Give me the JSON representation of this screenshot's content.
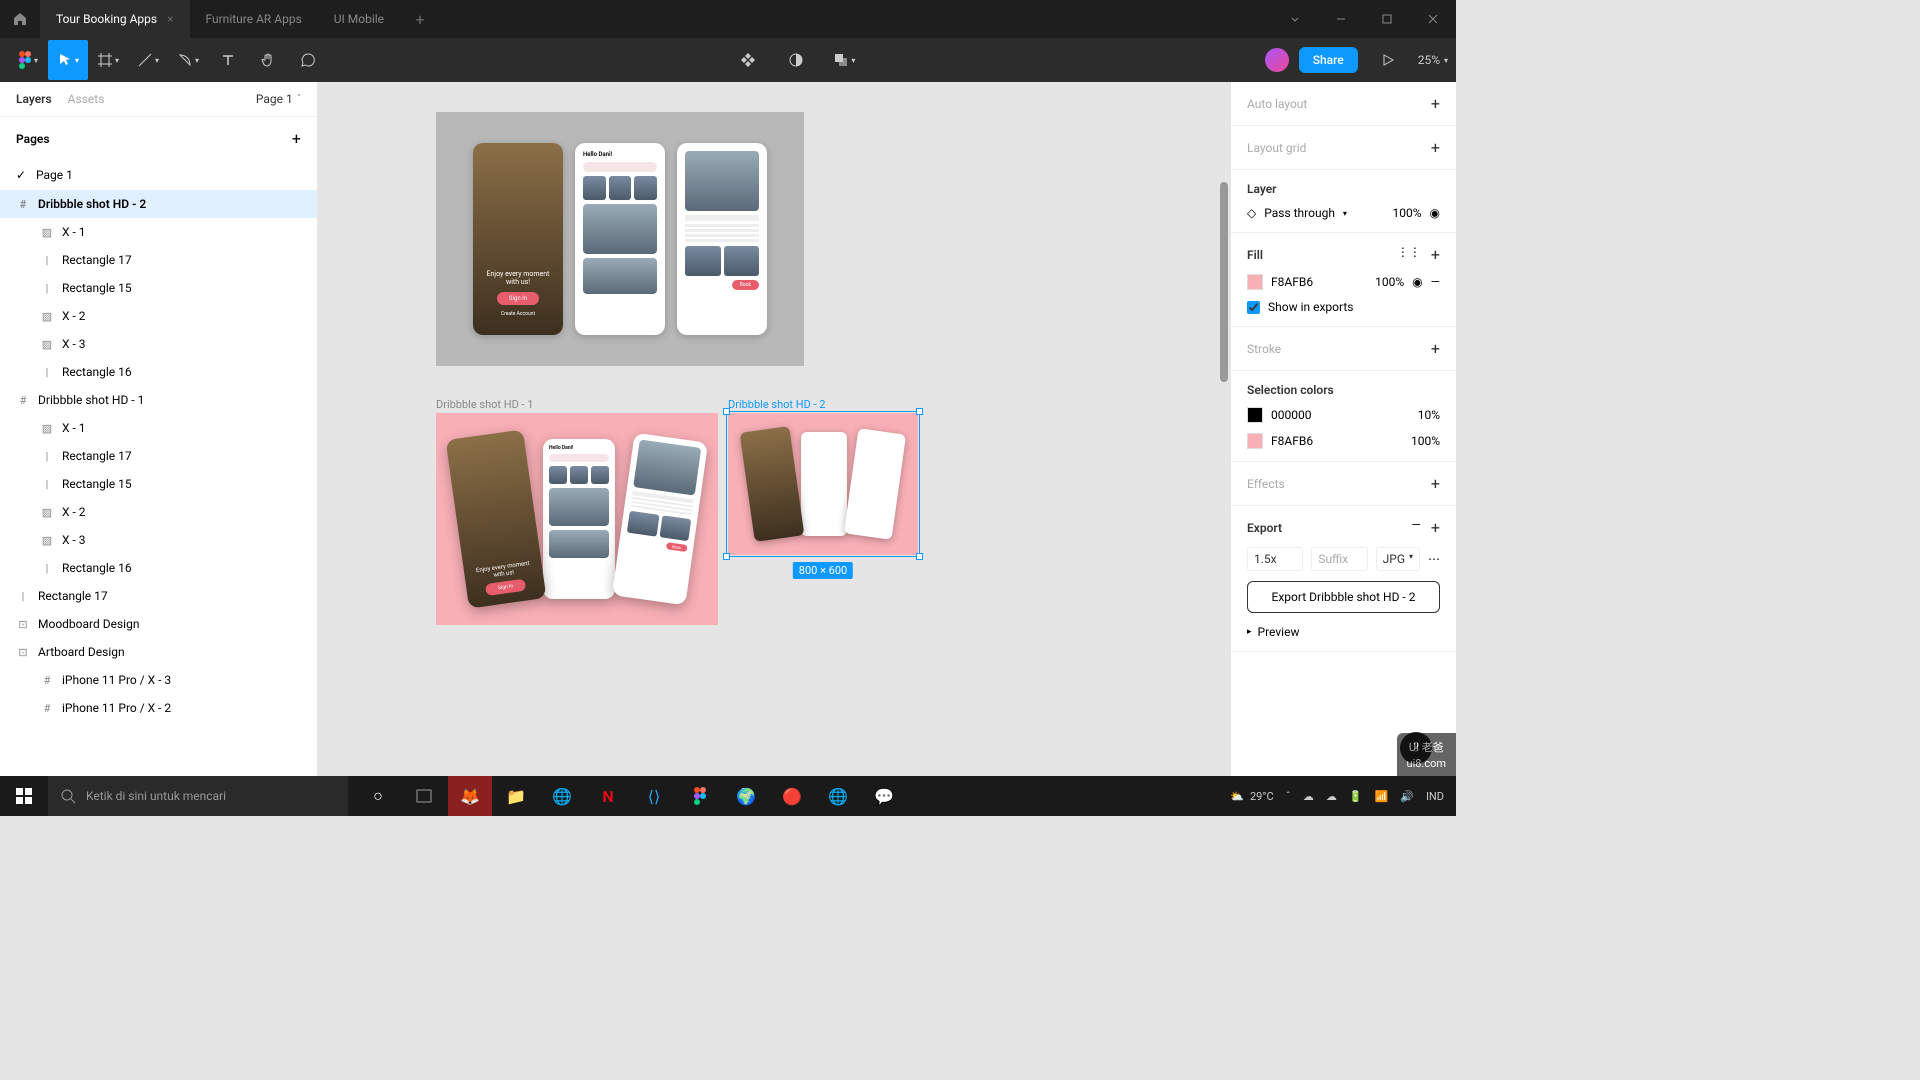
{
  "tabs": [
    {
      "label": "Tour Booking Apps",
      "active": true
    },
    {
      "label": "Furniture AR Apps",
      "active": false
    },
    {
      "label": "UI Mobile",
      "active": false
    }
  ],
  "toolbar": {
    "share": "Share",
    "zoom": "25%"
  },
  "leftPanel": {
    "tabLayers": "Layers",
    "tabAssets": "Assets",
    "pageSelector": "Page 1",
    "pagesHeader": "Pages",
    "pages": [
      {
        "name": "Page 1",
        "active": true
      }
    ],
    "layers": [
      {
        "name": "Dribbble shot HD - 2",
        "icon": "frame",
        "indent": 0,
        "selected": true
      },
      {
        "name": "X - 1",
        "icon": "image",
        "indent": 1
      },
      {
        "name": "Rectangle 17",
        "icon": "line",
        "indent": 1
      },
      {
        "name": "Rectangle 15",
        "icon": "line",
        "indent": 1
      },
      {
        "name": "X - 2",
        "icon": "image",
        "indent": 1
      },
      {
        "name": "X - 3",
        "icon": "image",
        "indent": 1
      },
      {
        "name": "Rectangle 16",
        "icon": "line",
        "indent": 1
      },
      {
        "name": "Dribbble shot HD - 1",
        "icon": "frame",
        "indent": 0
      },
      {
        "name": "X - 1",
        "icon": "image",
        "indent": 1
      },
      {
        "name": "Rectangle 17",
        "icon": "line",
        "indent": 1
      },
      {
        "name": "Rectangle 15",
        "icon": "line",
        "indent": 1
      },
      {
        "name": "X - 2",
        "icon": "image",
        "indent": 1
      },
      {
        "name": "X - 3",
        "icon": "image",
        "indent": 1
      },
      {
        "name": "Rectangle 16",
        "icon": "line",
        "indent": 1
      },
      {
        "name": "Rectangle 17",
        "icon": "line",
        "indent": 0
      },
      {
        "name": "Moodboard Design",
        "icon": "group",
        "indent": 0
      },
      {
        "name": "Artboard Design",
        "icon": "group",
        "indent": 0
      },
      {
        "name": "iPhone 11 Pro / X - 3",
        "icon": "frame",
        "indent": 1
      },
      {
        "name": "iPhone 11 Pro / X - 2",
        "icon": "frame",
        "indent": 1
      }
    ]
  },
  "canvas": {
    "frame1Label": "Dribbble shot HD - 1",
    "frame2Label": "Dribbble shot HD - 2",
    "selectionDim": "800 × 600",
    "mockText": "Enjoy every moment with us!",
    "mockBtn": "Sign In",
    "mockCreate": "Create Account",
    "mockHello": "Hello Dani!"
  },
  "rightPanel": {
    "autoLayout": "Auto layout",
    "layoutGrid": "Layout grid",
    "layer": "Layer",
    "passThrough": "Pass through",
    "passThroughPct": "100%",
    "fill": "Fill",
    "fillHex": "F8AFB6",
    "fillPct": "100%",
    "showInExports": "Show in exports",
    "stroke": "Stroke",
    "selectionColors": "Selection colors",
    "selColors": [
      {
        "hex": "000000",
        "pct": "10%",
        "color": "#000000"
      },
      {
        "hex": "F8AFB6",
        "pct": "100%",
        "color": "#F8AFB6"
      }
    ],
    "effects": "Effects",
    "export": "Export",
    "exportScale": "1.5x",
    "exportSuffix": "Suffix",
    "exportFormat": "JPG",
    "exportBtn": "Export Dribbble shot HD - 2",
    "preview": "Preview"
  },
  "taskbar": {
    "search": "Ketik di sini untuk mencari",
    "weather": "29°C",
    "lang": "IND"
  },
  "watermark": {
    "line1": "UI 老爸",
    "line2": "ui8.com"
  }
}
